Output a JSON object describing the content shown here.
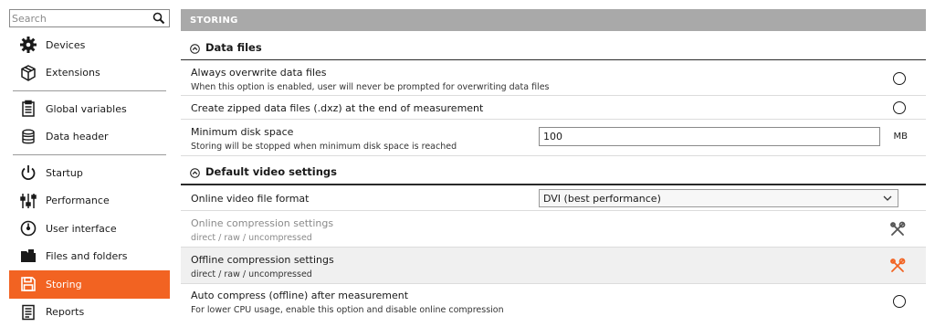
{
  "search": {
    "placeholder": "Search"
  },
  "sidebar": {
    "items": [
      {
        "label": "Devices",
        "icon": "gear-icon"
      },
      {
        "label": "Extensions",
        "icon": "cube-icon"
      },
      {
        "label": "Global variables",
        "icon": "clipboard-list-icon"
      },
      {
        "label": "Data header",
        "icon": "database-icon"
      },
      {
        "label": "Startup",
        "icon": "power-icon"
      },
      {
        "label": "Performance",
        "icon": "sliders-icon"
      },
      {
        "label": "User interface",
        "icon": "gauge-icon"
      },
      {
        "label": "Files and folders",
        "icon": "folder-icon"
      },
      {
        "label": "Storing",
        "icon": "save-icon",
        "active": true
      },
      {
        "label": "Reports",
        "icon": "report-icon"
      }
    ],
    "active_color": "#f26322"
  },
  "main": {
    "header": "STORING",
    "sections": [
      {
        "title": "Data files",
        "rows": [
          {
            "title": "Always overwrite data files",
            "subtitle": "When this option is enabled, user will never be prompted for overwriting data files"
          },
          {
            "title": "Create zipped data files (.dxz) at the end of measurement"
          },
          {
            "title": "Minimum disk space",
            "subtitle": "Storing will be stopped when minimum disk space is reached",
            "value": "100",
            "unit": "MB"
          }
        ]
      },
      {
        "title": "Default video settings",
        "rows": [
          {
            "title": "Online video file format",
            "selected": "DVI (best performance)"
          },
          {
            "title": "Online compression settings",
            "subtitle": "direct / raw / uncompressed"
          },
          {
            "title": "Offline compression settings",
            "subtitle": "direct / raw / uncompressed"
          },
          {
            "title": "Auto compress (offline) after measurement",
            "subtitle": "For lower CPU usage, enable this option and disable online compression"
          }
        ]
      }
    ]
  }
}
